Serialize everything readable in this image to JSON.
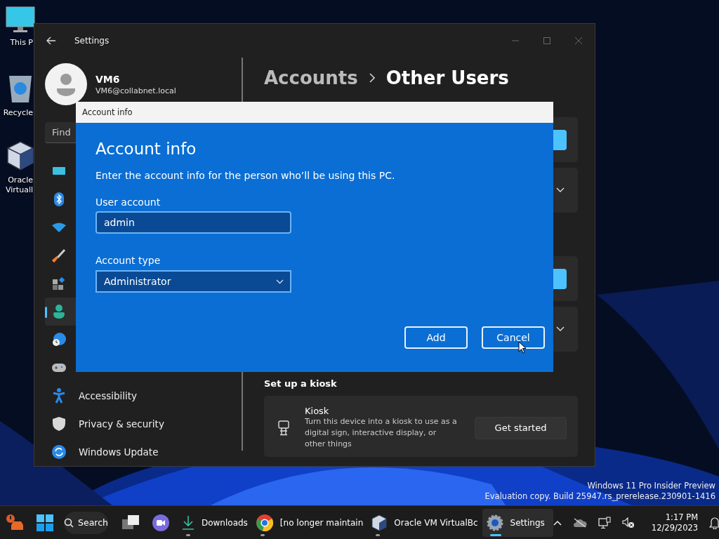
{
  "desktop_icons": [
    {
      "kind": "monitor",
      "lines": [
        "This P"
      ]
    },
    {
      "kind": "recycle",
      "lines": [
        "Recycle"
      ]
    },
    {
      "kind": "cube",
      "lines": [
        "Oracle",
        "Virtuall"
      ]
    }
  ],
  "settings": {
    "title": "Settings",
    "user": {
      "name": "VM6",
      "email": "VM6@collabnet.local"
    },
    "search": {
      "placeholder": "Find"
    },
    "nav": [
      {
        "kind": "system",
        "selected": false
      },
      {
        "kind": "bluetooth",
        "selected": false
      },
      {
        "kind": "wifi",
        "selected": false
      },
      {
        "kind": "brush",
        "selected": false
      },
      {
        "kind": "apps",
        "selected": false
      },
      {
        "kind": "person",
        "selected": true
      },
      {
        "kind": "clock",
        "selected": false
      },
      {
        "kind": "gamepad",
        "selected": false
      },
      {
        "kind": "accessibility",
        "label": "Accessibility",
        "selected": false
      },
      {
        "kind": "shield",
        "label": "Privacy & security",
        "selected": false
      },
      {
        "kind": "update",
        "label": "Windows Update",
        "selected": false
      }
    ],
    "breadcrumb": [
      "Accounts",
      "Other Users"
    ],
    "cards": [
      {
        "kind": "button"
      },
      {
        "kind": "expander"
      },
      {
        "kind": "gap"
      },
      {
        "kind": "button"
      },
      {
        "kind": "expander"
      }
    ],
    "kiosk": {
      "heading": "Set up a kiosk",
      "title": "Kiosk",
      "description": "Turn this device into a kiosk to use as a digital sign, interactive display, or other things",
      "button": "Get started"
    }
  },
  "dialog": {
    "title": "Account info",
    "heading": "Account info",
    "prompt": "Enter the account info for the person who’ll be using this PC.",
    "user_label": "User account",
    "user_value": "admin",
    "type_label": "Account type",
    "type_value": "Administrator",
    "buttons": [
      "Add",
      "Cancel"
    ]
  },
  "watermark": [
    "Windows 11 Pro Insider Preview",
    "Evaluation copy. Build 25947.rs_prerelease.230901-1416"
  ],
  "taskbar": {
    "search": "Search",
    "apps": [
      {
        "kind": "download",
        "label": "Downloads",
        "running": true,
        "selected": false
      },
      {
        "kind": "chrome",
        "label": "[no longer maintain",
        "running": true,
        "selected": false
      },
      {
        "kind": "cube",
        "label": "Oracle VM VirtualBc",
        "running": true,
        "selected": false
      },
      {
        "kind": "gear",
        "label": "Settings",
        "running": true,
        "selected": true
      }
    ],
    "time": "1:17 PM",
    "date": "12/29/2023"
  }
}
